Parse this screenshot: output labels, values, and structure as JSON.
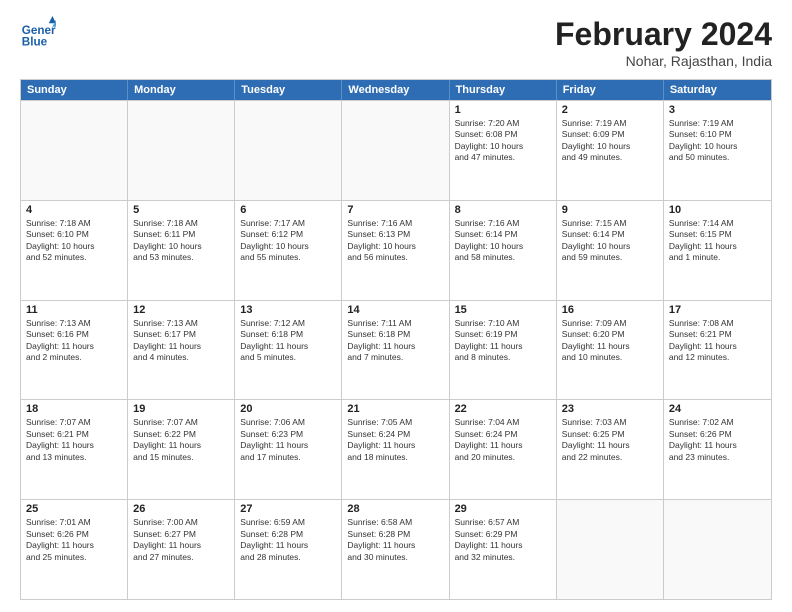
{
  "header": {
    "logo_line1": "General",
    "logo_line2": "Blue",
    "title": "February 2024",
    "subtitle": "Nohar, Rajasthan, India"
  },
  "days": [
    "Sunday",
    "Monday",
    "Tuesday",
    "Wednesday",
    "Thursday",
    "Friday",
    "Saturday"
  ],
  "weeks": [
    [
      {
        "day": "",
        "info": ""
      },
      {
        "day": "",
        "info": ""
      },
      {
        "day": "",
        "info": ""
      },
      {
        "day": "",
        "info": ""
      },
      {
        "day": "1",
        "info": "Sunrise: 7:20 AM\nSunset: 6:08 PM\nDaylight: 10 hours\nand 47 minutes."
      },
      {
        "day": "2",
        "info": "Sunrise: 7:19 AM\nSunset: 6:09 PM\nDaylight: 10 hours\nand 49 minutes."
      },
      {
        "day": "3",
        "info": "Sunrise: 7:19 AM\nSunset: 6:10 PM\nDaylight: 10 hours\nand 50 minutes."
      }
    ],
    [
      {
        "day": "4",
        "info": "Sunrise: 7:18 AM\nSunset: 6:10 PM\nDaylight: 10 hours\nand 52 minutes."
      },
      {
        "day": "5",
        "info": "Sunrise: 7:18 AM\nSunset: 6:11 PM\nDaylight: 10 hours\nand 53 minutes."
      },
      {
        "day": "6",
        "info": "Sunrise: 7:17 AM\nSunset: 6:12 PM\nDaylight: 10 hours\nand 55 minutes."
      },
      {
        "day": "7",
        "info": "Sunrise: 7:16 AM\nSunset: 6:13 PM\nDaylight: 10 hours\nand 56 minutes."
      },
      {
        "day": "8",
        "info": "Sunrise: 7:16 AM\nSunset: 6:14 PM\nDaylight: 10 hours\nand 58 minutes."
      },
      {
        "day": "9",
        "info": "Sunrise: 7:15 AM\nSunset: 6:14 PM\nDaylight: 10 hours\nand 59 minutes."
      },
      {
        "day": "10",
        "info": "Sunrise: 7:14 AM\nSunset: 6:15 PM\nDaylight: 11 hours\nand 1 minute."
      }
    ],
    [
      {
        "day": "11",
        "info": "Sunrise: 7:13 AM\nSunset: 6:16 PM\nDaylight: 11 hours\nand 2 minutes."
      },
      {
        "day": "12",
        "info": "Sunrise: 7:13 AM\nSunset: 6:17 PM\nDaylight: 11 hours\nand 4 minutes."
      },
      {
        "day": "13",
        "info": "Sunrise: 7:12 AM\nSunset: 6:18 PM\nDaylight: 11 hours\nand 5 minutes."
      },
      {
        "day": "14",
        "info": "Sunrise: 7:11 AM\nSunset: 6:18 PM\nDaylight: 11 hours\nand 7 minutes."
      },
      {
        "day": "15",
        "info": "Sunrise: 7:10 AM\nSunset: 6:19 PM\nDaylight: 11 hours\nand 8 minutes."
      },
      {
        "day": "16",
        "info": "Sunrise: 7:09 AM\nSunset: 6:20 PM\nDaylight: 11 hours\nand 10 minutes."
      },
      {
        "day": "17",
        "info": "Sunrise: 7:08 AM\nSunset: 6:21 PM\nDaylight: 11 hours\nand 12 minutes."
      }
    ],
    [
      {
        "day": "18",
        "info": "Sunrise: 7:07 AM\nSunset: 6:21 PM\nDaylight: 11 hours\nand 13 minutes."
      },
      {
        "day": "19",
        "info": "Sunrise: 7:07 AM\nSunset: 6:22 PM\nDaylight: 11 hours\nand 15 minutes."
      },
      {
        "day": "20",
        "info": "Sunrise: 7:06 AM\nSunset: 6:23 PM\nDaylight: 11 hours\nand 17 minutes."
      },
      {
        "day": "21",
        "info": "Sunrise: 7:05 AM\nSunset: 6:24 PM\nDaylight: 11 hours\nand 18 minutes."
      },
      {
        "day": "22",
        "info": "Sunrise: 7:04 AM\nSunset: 6:24 PM\nDaylight: 11 hours\nand 20 minutes."
      },
      {
        "day": "23",
        "info": "Sunrise: 7:03 AM\nSunset: 6:25 PM\nDaylight: 11 hours\nand 22 minutes."
      },
      {
        "day": "24",
        "info": "Sunrise: 7:02 AM\nSunset: 6:26 PM\nDaylight: 11 hours\nand 23 minutes."
      }
    ],
    [
      {
        "day": "25",
        "info": "Sunrise: 7:01 AM\nSunset: 6:26 PM\nDaylight: 11 hours\nand 25 minutes."
      },
      {
        "day": "26",
        "info": "Sunrise: 7:00 AM\nSunset: 6:27 PM\nDaylight: 11 hours\nand 27 minutes."
      },
      {
        "day": "27",
        "info": "Sunrise: 6:59 AM\nSunset: 6:28 PM\nDaylight: 11 hours\nand 28 minutes."
      },
      {
        "day": "28",
        "info": "Sunrise: 6:58 AM\nSunset: 6:28 PM\nDaylight: 11 hours\nand 30 minutes."
      },
      {
        "day": "29",
        "info": "Sunrise: 6:57 AM\nSunset: 6:29 PM\nDaylight: 11 hours\nand 32 minutes."
      },
      {
        "day": "",
        "info": ""
      },
      {
        "day": "",
        "info": ""
      }
    ]
  ]
}
